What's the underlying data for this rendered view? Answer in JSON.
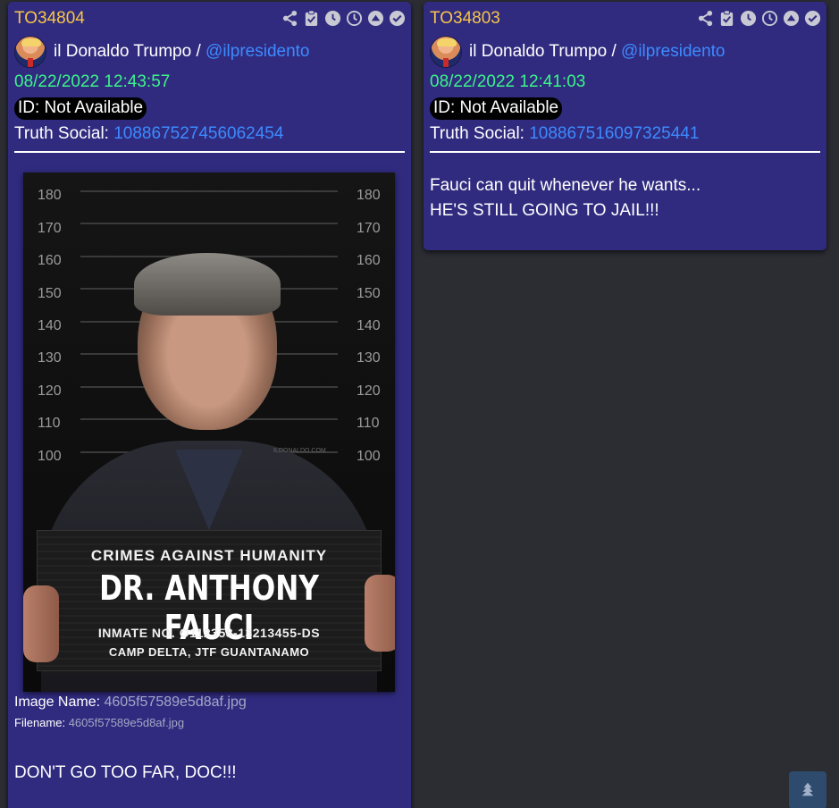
{
  "posts": [
    {
      "id": "TO34804",
      "author_name": "il Donaldo Trumpo / ",
      "author_handle": "@ilpresidento",
      "timestamp": "08/22/2022 12:43:57",
      "id_badge": "ID: Not Available",
      "truth_label": "Truth Social: ",
      "truth_id": "108867527456062454",
      "image": {
        "height_marks": [
          "180",
          "170",
          "160",
          "150",
          "140",
          "130",
          "120",
          "110",
          "100"
        ],
        "watermark": "ILDONALDO.COM",
        "placard_line1": "CRIMES AGAINST HUMANITY",
        "placard_name": "DR. ANTHONY FAUCI",
        "placard_inmate": "INMATE NO. O112358-13213455-DS",
        "placard_location": "CAMP DELTA, JTF GUANTANAMO"
      },
      "image_name_label": "Image Name: ",
      "image_name": "4605f57589e5d8af.jpg",
      "filename_label": "Filename: ",
      "filename": "4605f57589e5d8af.jpg",
      "body_lines": [
        "DON'T GO TOO FAR, DOC!!!"
      ]
    },
    {
      "id": "TO34803",
      "author_name": "il Donaldo Trumpo / ",
      "author_handle": "@ilpresidento",
      "timestamp": "08/22/2022 12:41:03",
      "id_badge": "ID: Not Available",
      "truth_label": "Truth Social: ",
      "truth_id": "108867516097325441",
      "body_lines": [
        "Fauci can quit whenever he wants...",
        "HE'S STILL GOING TO JAIL!!!"
      ]
    }
  ],
  "toolbar_icons": [
    "share-icon",
    "clipboard-check-icon",
    "clock-filled-icon",
    "clock-outline-icon",
    "chevron-up-circle-icon",
    "check-circle-icon"
  ],
  "colors": {
    "page_bg": "#2b2d33",
    "card_bg": "#302b7f",
    "post_id": "#f7c548",
    "timestamp": "#3cf58a",
    "link": "#3d8bff",
    "scroll_button": "#2e4b6d"
  }
}
